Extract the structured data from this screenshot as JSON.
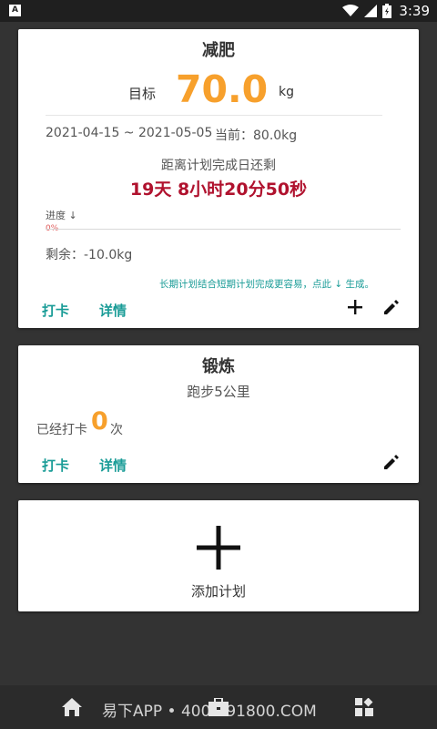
{
  "status_bar": {
    "time": "3:39",
    "icons": [
      "app-notification-icon",
      "wifi-icon",
      "signal-icon",
      "battery-icon"
    ]
  },
  "plan_card_weight": {
    "title": "减肥",
    "goal_label": "目标",
    "goal_value": "70.0",
    "goal_unit": "kg",
    "date_range": "2021-04-15 ~ 2021-05-05",
    "current": "当前：80.0kg",
    "remaining_label": "距离计划完成日还剩",
    "remaining_value": "19天  8小时20分50秒",
    "progress_label": "进度 ↓",
    "progress_percent_text": "0%",
    "progress_fraction": 0.0,
    "remaining_weight": "剩余：-10.0kg",
    "tip": "长期计划结合短期计划完成更容易，点此 ↓ 生成。",
    "checkin_label": "打卡",
    "details_label": "详情",
    "add_icon": "plus-icon",
    "edit_icon": "pencil-icon"
  },
  "plan_card_exercise": {
    "title": "锻炼",
    "subtitle": "跑步5公里",
    "checked_label": "已经打卡",
    "checked_count": "0",
    "checked_unit": "次",
    "checkin_label": "打卡",
    "details_label": "详情",
    "edit_icon": "pencil-icon"
  },
  "add_plan_card": {
    "icon": "big-plus-icon",
    "label": "添加计划"
  },
  "bottom_bar": {
    "watermark": "易下APP • 400-891800.COM",
    "icons": [
      "home-icon",
      "briefcase-icon",
      "grid-icon"
    ]
  },
  "colors": {
    "background": "#333333",
    "accent_teal": "#1a9c97",
    "goal_orange": "#f7a02c",
    "countdown_red": "#b0122e"
  }
}
